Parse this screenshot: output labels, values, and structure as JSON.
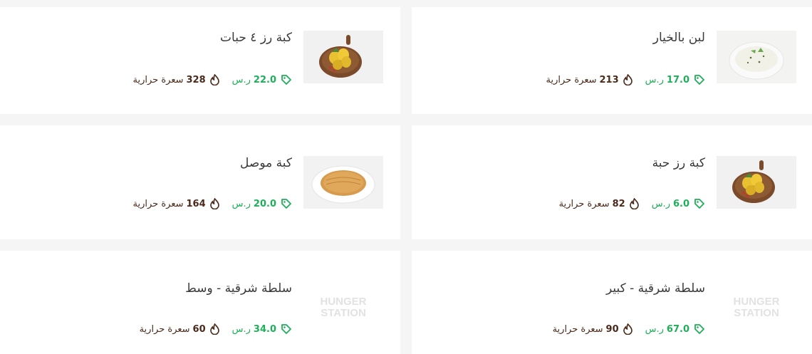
{
  "items": [
    {
      "name": "لبن بالخيار",
      "price": "17.0",
      "currency": "ر.س",
      "calories": "213",
      "cal_unit": "سعرة حرارية",
      "image": "yogurt-cucumber-bowl"
    },
    {
      "name": "كبة رز ٤ حبات",
      "price": "22.0",
      "currency": "ر.س",
      "calories": "328",
      "cal_unit": "سعرة حرارية",
      "image": "kubba-plate"
    },
    {
      "name": "كبة رز حبة",
      "price": "6.0",
      "currency": "ر.س",
      "calories": "82",
      "cal_unit": "سعرة حرارية",
      "image": "kubba-plate"
    },
    {
      "name": "كبة موصل",
      "price": "20.0",
      "currency": "ر.س",
      "calories": "164",
      "cal_unit": "سعرة حرارية",
      "image": "kubba-mosul-plate"
    },
    {
      "name": "سلطة شرقية - كبير",
      "price": "67.0",
      "currency": "ر.س",
      "calories": "90",
      "cal_unit": "سعرة حرارية",
      "image": "hungerstation-logo",
      "logo_text": [
        "HUNGER",
        "STATION"
      ]
    },
    {
      "name": "سلطة شرقية - وسط",
      "price": "34.0",
      "currency": "ر.س",
      "calories": "60",
      "cal_unit": "سعرة حرارية",
      "image": "hungerstation-logo",
      "logo_text": [
        "HUNGER",
        "STATION"
      ]
    }
  ],
  "colors": {
    "price": "#1fae5a",
    "calories": "#4a2a1a",
    "name": "#3a3a3a"
  }
}
